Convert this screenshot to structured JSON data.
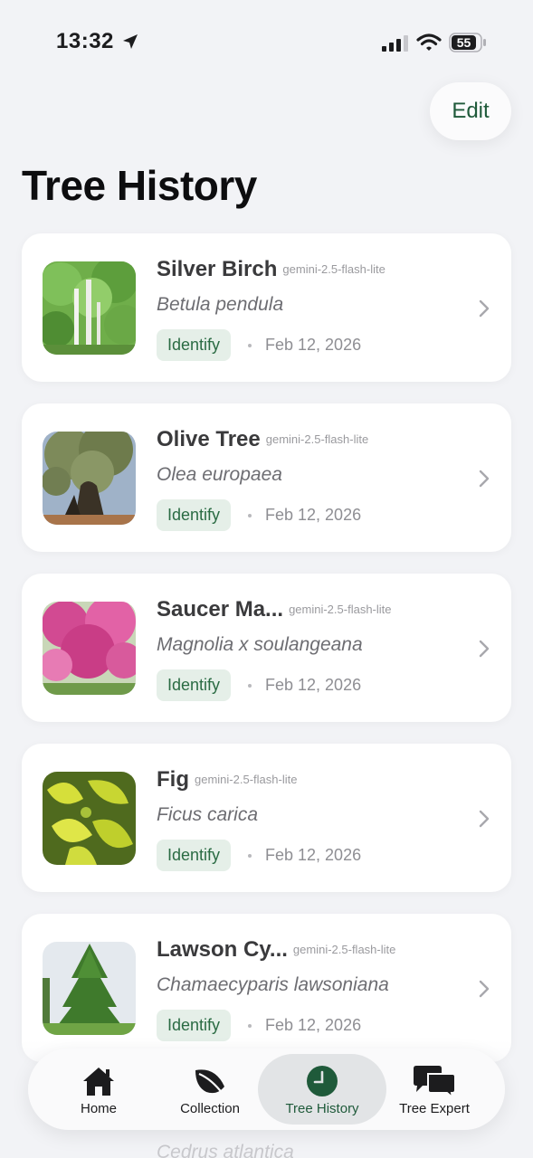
{
  "status_bar": {
    "time": "13:32",
    "battery": "55"
  },
  "header": {
    "edit_label": "Edit",
    "title": "Tree History"
  },
  "items": [
    {
      "name": "Silver Birch",
      "model": "gemini-2.5-flash-lite",
      "scientific": "Betula pendula",
      "badge": "Identify",
      "date": "Feb 12, 2026"
    },
    {
      "name": "Olive Tree",
      "model": "gemini-2.5-flash-lite",
      "scientific": "Olea europaea",
      "badge": "Identify",
      "date": "Feb 12, 2026"
    },
    {
      "name": "Saucer Ma...",
      "model": "gemini-2.5-flash-lite",
      "scientific": "Magnolia x soulangeana",
      "badge": "Identify",
      "date": "Feb 12, 2026"
    },
    {
      "name": "Fig",
      "model": "gemini-2.5-flash-lite",
      "scientific": "Ficus carica",
      "badge": "Identify",
      "date": "Feb 12, 2026"
    },
    {
      "name": "Lawson Cy...",
      "model": "gemini-2.5-flash-lite",
      "scientific": "Chamaecyparis lawsoniana",
      "badge": "Identify",
      "date": "Feb 12, 2026"
    }
  ],
  "peek_item": {
    "scientific": "Cedrus atlantica"
  },
  "tab_bar": {
    "tabs": [
      {
        "label": "Home",
        "icon": "home-icon"
      },
      {
        "label": "Collection",
        "icon": "leaf-icon"
      },
      {
        "label": "Tree History",
        "icon": "clock-icon",
        "active": true
      },
      {
        "label": "Tree Expert",
        "icon": "chat-icon"
      }
    ]
  },
  "colors": {
    "accent": "#1f5a3a",
    "badge_bg": "#e5efe8",
    "background": "#f2f3f6"
  }
}
